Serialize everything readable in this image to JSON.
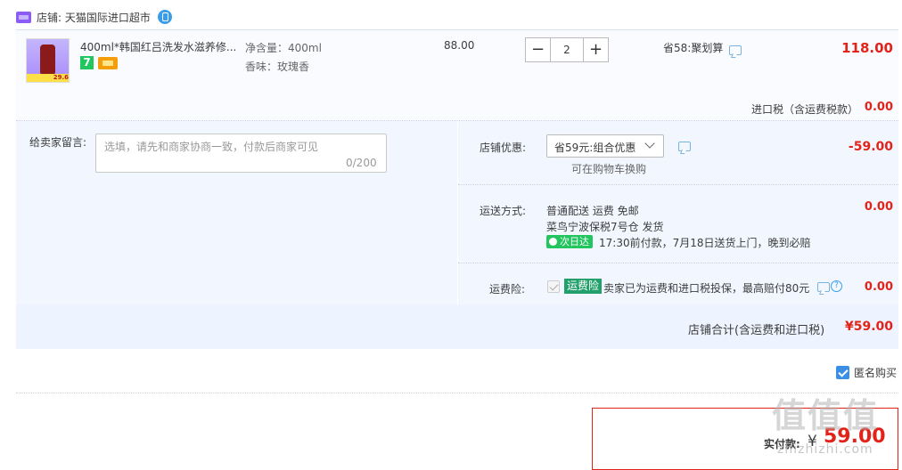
{
  "shop": {
    "label": "店铺: 天猫国际进口超市"
  },
  "item": {
    "title": "400ml*韩国红吕洗发水滋养修...",
    "img_tag_price": "29.6",
    "tag_seven": "7",
    "spec_volume": "净含量：400ml",
    "spec_scent": "香味：玫瑰香",
    "unit_price": "88.00",
    "quantity": "2",
    "qty_minus": "−",
    "qty_plus": "+",
    "discount": "省58:聚划算",
    "subtotal": "118.00"
  },
  "tax": {
    "label": "进口税（含运费税款）",
    "value": "0.00"
  },
  "message": {
    "label": "给卖家留言:",
    "placeholder": "选填，请先和商家协商一致，付款后商家可见",
    "count": "0/200"
  },
  "store_discount": {
    "label": "店铺优惠:",
    "selected": "省59元:组合优惠",
    "hint": "可在购物车换购",
    "value": "-59.00"
  },
  "shipping": {
    "label": "运送方式:",
    "line1": "普通配送 运费 免邮",
    "line2": "菜鸟宁波保税7号仓  发货",
    "badge": "次日达",
    "line3": "17:30前付款，7月18日送货上门，晚到必赔",
    "value": "0.00"
  },
  "insurance": {
    "label": "运费险:",
    "badge": "运费险",
    "text": "卖家已为运费和进口税投保，最高赔付80元",
    "help": "?",
    "value": "0.00"
  },
  "shop_total": {
    "label": "店铺合计(含运费和进口税)",
    "value": "¥59.00"
  },
  "anonymous": {
    "label": "匿名购买"
  },
  "payment": {
    "label": "实付款:",
    "currency": "¥",
    "amount": "59.00"
  },
  "watermark": {
    "logo": "值值值",
    "url": "zhizhizhi.com"
  },
  "colors": {
    "price_red": "#e2231a",
    "accent_blue": "#3a8ee6",
    "green": "#22c55e",
    "panel_bg": "#f2f7ff"
  },
  "icons": [
    "shop-icon",
    "verified-badge-icon",
    "chat-icon",
    "chevron-down-icon",
    "help-icon",
    "checkbox-icon"
  ]
}
